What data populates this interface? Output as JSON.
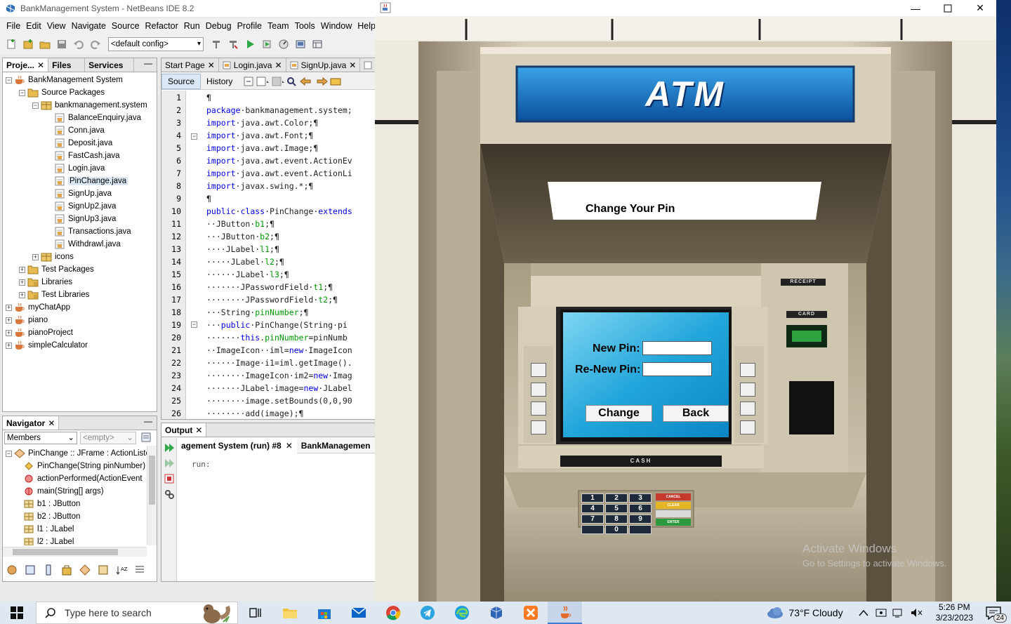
{
  "netbeans": {
    "title": "BankManagement System - NetBeans IDE 8.2",
    "menu": [
      "File",
      "Edit",
      "View",
      "Navigate",
      "Source",
      "Refactor",
      "Run",
      "Debug",
      "Profile",
      "Team",
      "Tools",
      "Window",
      "Help"
    ],
    "config": "<default config>",
    "project_tabs": [
      "Proje...",
      "Files",
      "Services"
    ],
    "project_tree": [
      {
        "label": "BankManagement System",
        "level": 0,
        "icon": "coffee-cup-icon",
        "expanded": true
      },
      {
        "label": "Source Packages",
        "level": 1,
        "icon": "package-folder-icon",
        "expanded": true
      },
      {
        "label": "bankmanagement.system",
        "level": 2,
        "icon": "package-icon",
        "expanded": true
      },
      {
        "label": "BalanceEnquiry.java",
        "level": 3,
        "icon": "java-file-icon"
      },
      {
        "label": "Conn.java",
        "level": 3,
        "icon": "java-file-icon"
      },
      {
        "label": "Deposit.java",
        "level": 3,
        "icon": "java-file-icon"
      },
      {
        "label": "FastCash.java",
        "level": 3,
        "icon": "java-file-icon"
      },
      {
        "label": "Login.java",
        "level": 3,
        "icon": "java-file-icon"
      },
      {
        "label": "PinChange.java",
        "level": 3,
        "icon": "java-file-icon",
        "selected": true
      },
      {
        "label": "SignUp.java",
        "level": 3,
        "icon": "java-file-icon"
      },
      {
        "label": "SignUp2.java",
        "level": 3,
        "icon": "java-file-icon"
      },
      {
        "label": "SignUp3.java",
        "level": 3,
        "icon": "java-file-icon"
      },
      {
        "label": "Transactions.java",
        "level": 3,
        "icon": "java-file-icon"
      },
      {
        "label": "Withdrawl.java",
        "level": 3,
        "icon": "java-file-icon"
      },
      {
        "label": "icons",
        "level": 2,
        "icon": "package-icon",
        "expanded": false
      },
      {
        "label": "Test Packages",
        "level": 1,
        "icon": "package-folder-icon",
        "expanded": false
      },
      {
        "label": "Libraries",
        "level": 1,
        "icon": "library-folder-icon",
        "expanded": false
      },
      {
        "label": "Test Libraries",
        "level": 1,
        "icon": "library-folder-icon",
        "expanded": false
      },
      {
        "label": "myChatApp",
        "level": 0,
        "icon": "coffee-cup-icon",
        "expanded": false
      },
      {
        "label": "piano",
        "level": 0,
        "icon": "coffee-cup-icon",
        "expanded": false
      },
      {
        "label": "pianoProject",
        "level": 0,
        "icon": "coffee-cup-icon",
        "expanded": false
      },
      {
        "label": "simpleCalculator",
        "level": 0,
        "icon": "coffee-cup-icon",
        "expanded": false
      }
    ],
    "navigator": {
      "title": "Navigator",
      "filter": "Members",
      "filter2": "<empty>",
      "items": [
        {
          "label": "PinChange :: JFrame : ActionListe",
          "level": 0,
          "icon": "class-icon"
        },
        {
          "label": "PinChange(String pinNumber)",
          "level": 1,
          "icon": "constructor-icon"
        },
        {
          "label": "actionPerformed(ActionEvent",
          "level": 1,
          "icon": "method-icon"
        },
        {
          "label": "main(String[] args)",
          "level": 1,
          "icon": "static-method-icon"
        },
        {
          "label": "b1 : JButton",
          "level": 1,
          "icon": "field-icon"
        },
        {
          "label": "b2 : JButton",
          "level": 1,
          "icon": "field-icon"
        },
        {
          "label": "l1 : JLabel",
          "level": 1,
          "icon": "field-icon"
        },
        {
          "label": "l2 : JLabel",
          "level": 1,
          "icon": "field-icon"
        }
      ]
    },
    "editor_tabs": [
      "Start Page",
      "Login.java",
      "SignUp.java"
    ],
    "editor_subtabs": [
      "Source",
      "History"
    ],
    "code_lines": [
      {
        "n": "1",
        "segs": [
          {
            "t": "¶",
            "c": ""
          }
        ]
      },
      {
        "n": "2",
        "segs": [
          {
            "t": "package",
            "c": "kw"
          },
          {
            "t": "·bankmanagement.system;",
            "c": ""
          }
        ]
      },
      {
        "n": "3",
        "segs": [
          {
            "t": "import",
            "c": "kw"
          },
          {
            "t": "·java.awt.Color;¶",
            "c": ""
          }
        ]
      },
      {
        "n": "4",
        "segs": [
          {
            "t": "import",
            "c": "kw"
          },
          {
            "t": "·java.awt.Font;¶",
            "c": ""
          }
        ]
      },
      {
        "n": "5",
        "segs": [
          {
            "t": "import",
            "c": "kw"
          },
          {
            "t": "·java.awt.Image;¶",
            "c": ""
          }
        ]
      },
      {
        "n": "6",
        "segs": [
          {
            "t": "import",
            "c": "kw"
          },
          {
            "t": "·java.awt.event.ActionEv",
            "c": ""
          }
        ]
      },
      {
        "n": "7",
        "segs": [
          {
            "t": "import",
            "c": "kw"
          },
          {
            "t": "·java.awt.event.ActionLi",
            "c": ""
          }
        ]
      },
      {
        "n": "8",
        "segs": [
          {
            "t": "import",
            "c": "kw"
          },
          {
            "t": "·javax.swing.*;¶",
            "c": ""
          }
        ]
      },
      {
        "n": "9",
        "segs": [
          {
            "t": "¶",
            "c": ""
          }
        ]
      },
      {
        "n": "10",
        "segs": [
          {
            "t": "public",
            "c": "kw"
          },
          {
            "t": "·",
            "c": ""
          },
          {
            "t": "class",
            "c": "kw"
          },
          {
            "t": "·PinChange·",
            "c": ""
          },
          {
            "t": "extends",
            "c": "kw"
          }
        ]
      },
      {
        "n": "11",
        "segs": [
          {
            "t": "··JButton·",
            "c": ""
          },
          {
            "t": "b1",
            "c": "fld"
          },
          {
            "t": ";¶",
            "c": ""
          }
        ]
      },
      {
        "n": "12",
        "segs": [
          {
            "t": "···JButton·",
            "c": ""
          },
          {
            "t": "b2",
            "c": "fld"
          },
          {
            "t": ";¶",
            "c": ""
          }
        ]
      },
      {
        "n": "13",
        "segs": [
          {
            "t": "····JLabel·",
            "c": ""
          },
          {
            "t": "l1",
            "c": "fld"
          },
          {
            "t": ";¶",
            "c": ""
          }
        ]
      },
      {
        "n": "14",
        "segs": [
          {
            "t": "·····JLabel·",
            "c": ""
          },
          {
            "t": "l2",
            "c": "fld"
          },
          {
            "t": ";¶",
            "c": ""
          }
        ]
      },
      {
        "n": "15",
        "segs": [
          {
            "t": "······JLabel·",
            "c": ""
          },
          {
            "t": "l3",
            "c": "fld"
          },
          {
            "t": ";¶",
            "c": ""
          }
        ]
      },
      {
        "n": "16",
        "segs": [
          {
            "t": "·······JPasswordField·",
            "c": ""
          },
          {
            "t": "t1",
            "c": "fld"
          },
          {
            "t": ";¶",
            "c": ""
          }
        ]
      },
      {
        "n": "17",
        "segs": [
          {
            "t": "········JPasswordField·",
            "c": ""
          },
          {
            "t": "t2",
            "c": "fld"
          },
          {
            "t": ";¶",
            "c": ""
          }
        ]
      },
      {
        "n": "18",
        "segs": [
          {
            "t": "···String·",
            "c": ""
          },
          {
            "t": "pinNumber",
            "c": "fld"
          },
          {
            "t": ";¶",
            "c": ""
          }
        ]
      },
      {
        "n": "19",
        "segs": [
          {
            "t": "···",
            "c": ""
          },
          {
            "t": "public",
            "c": "kw"
          },
          {
            "t": "·PinChange(String·pi",
            "c": ""
          }
        ]
      },
      {
        "n": "20",
        "segs": [
          {
            "t": "·······",
            "c": ""
          },
          {
            "t": "this",
            "c": "kw"
          },
          {
            "t": ".",
            "c": ""
          },
          {
            "t": "pinNumber",
            "c": "fld"
          },
          {
            "t": "=pinNumb",
            "c": ""
          }
        ]
      },
      {
        "n": "21",
        "segs": [
          {
            "t": "··ImageIcon··iml=",
            "c": ""
          },
          {
            "t": "new",
            "c": "kw"
          },
          {
            "t": "·ImageIcon",
            "c": ""
          }
        ]
      },
      {
        "n": "22",
        "segs": [
          {
            "t": "······Image·i1=iml.getImage().",
            "c": ""
          }
        ]
      },
      {
        "n": "23",
        "segs": [
          {
            "t": "········ImageIcon·im2=",
            "c": ""
          },
          {
            "t": "new",
            "c": "kw"
          },
          {
            "t": "·Imag",
            "c": ""
          }
        ]
      },
      {
        "n": "24",
        "segs": [
          {
            "t": "·······JLabel·image=",
            "c": ""
          },
          {
            "t": "new",
            "c": "kw"
          },
          {
            "t": "·JLabel",
            "c": ""
          }
        ]
      },
      {
        "n": "25",
        "segs": [
          {
            "t": "········image.setBounds(0,0,90",
            "c": ""
          }
        ]
      },
      {
        "n": "26",
        "segs": [
          {
            "t": "········add(image);¶",
            "c": ""
          }
        ]
      }
    ],
    "output": {
      "title": "Output",
      "tab1": "agement System (run) #8",
      "tab2": "BankManagemen",
      "text": "run:"
    }
  },
  "atm": {
    "sign": "ATM",
    "screen_title": "Change Your Pin",
    "new_pin_label": "New Pin:",
    "renew_pin_label": "Re-New Pin:",
    "new_pin_value": "",
    "renew_pin_value": "",
    "change_button": "Change",
    "back_button": "Back",
    "receipt_label": "RECEIPT",
    "card_label": "CARD",
    "cash_label": "CASH",
    "keypad": [
      "1",
      "2",
      "3",
      "4",
      "5",
      "6",
      "7",
      "8",
      "9",
      "",
      "0",
      ""
    ],
    "keypad_side": [
      "CANCEL",
      "CLEAR",
      "",
      "ENTER"
    ]
  },
  "watermark": {
    "line1": "Activate Windows",
    "line2": "Go to Settings to activate Windows."
  },
  "taskbar": {
    "search_placeholder": "Type here to search",
    "weather": "73°F  Cloudy",
    "time": "5:26 PM",
    "date": "3/23/2023",
    "notifications": "24"
  }
}
